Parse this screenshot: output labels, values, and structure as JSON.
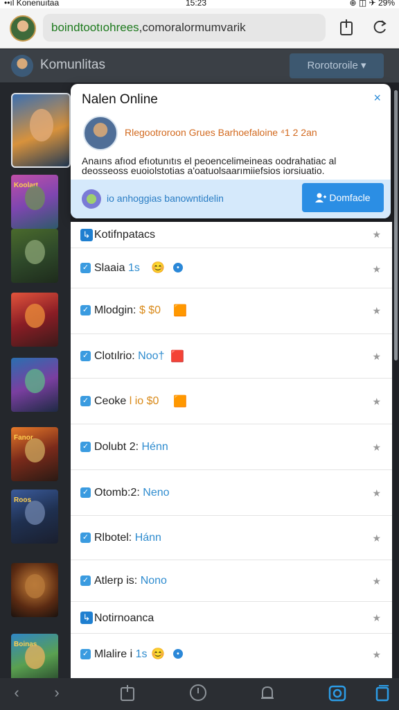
{
  "status_bar": {
    "carrier": "••ıl Konenuıtaa",
    "time": "15:23",
    "battery": "29%"
  },
  "browser": {
    "url_domain": "boindtootıohrees",
    "url_path": ",comoralormumvarik",
    "profile_icon": "profile-avatar",
    "share_icon": "share-icon",
    "reload_icon": "reload-icon"
  },
  "page_header": {
    "title": "Komunlitas",
    "button_label": "Rorotoroile",
    "chevron": "▾"
  },
  "popup": {
    "title": "Nalen Online",
    "close_label": "×",
    "highlight": "Rlegootroroon Grues Barhoefaloine ⁴1 2 2an",
    "description": "Anaıns afıod efıotunıtıs el peoencelimeineas oodrahatiac al deosseoss euoiolstotias a'oatuolsaarımiiefsios iorsiuatio.",
    "strip_text": "io anhoggias banowntidelin",
    "strip_button_label": "Domfacle",
    "strip_button_icon": "user-add-icon"
  },
  "settings_rows": [
    {
      "label": "Kotifnpatacs",
      "value": "",
      "section": true
    },
    {
      "label": "Slaaia",
      "value": "1s",
      "emoji": "😊",
      "pill": "•"
    },
    {
      "label": "Mlodgin:",
      "value": "$ $0",
      "value_orange": true,
      "extra": "🟧"
    },
    {
      "label": "Clotılrio:",
      "value": "Noo†",
      "extra": "🟥"
    },
    {
      "label": "Ceoke",
      "value": "l io $0",
      "value_orange": true,
      "extra": "🟧"
    },
    {
      "label": "Dolubt 2:",
      "value": "Hénn"
    },
    {
      "label": "Otomb:2:",
      "value": "Neno"
    },
    {
      "label": "Rlbotel:",
      "value": "Hánn"
    },
    {
      "label": "Atlerp is:",
      "value": "Nono"
    },
    {
      "label": "Notirnoanca",
      "value": "",
      "section": true
    },
    {
      "label": "Mlalire i",
      "value": "1s",
      "emoji": "😊",
      "pill": "•"
    }
  ],
  "thumb_captions": [
    "",
    "Koolart",
    "",
    "",
    "",
    "Fanor",
    "Roos",
    "",
    "Boinas"
  ],
  "bottom_toolbar": [
    "back-icon",
    "forward-icon",
    "bookmarks-icon",
    "history-icon",
    "notifications-icon",
    "camera-icon",
    "tabs-icon"
  ],
  "colors": {
    "accent": "#2b8ee4",
    "header_bg": "#3b4046",
    "popup_strip": "#d5e9fb"
  }
}
